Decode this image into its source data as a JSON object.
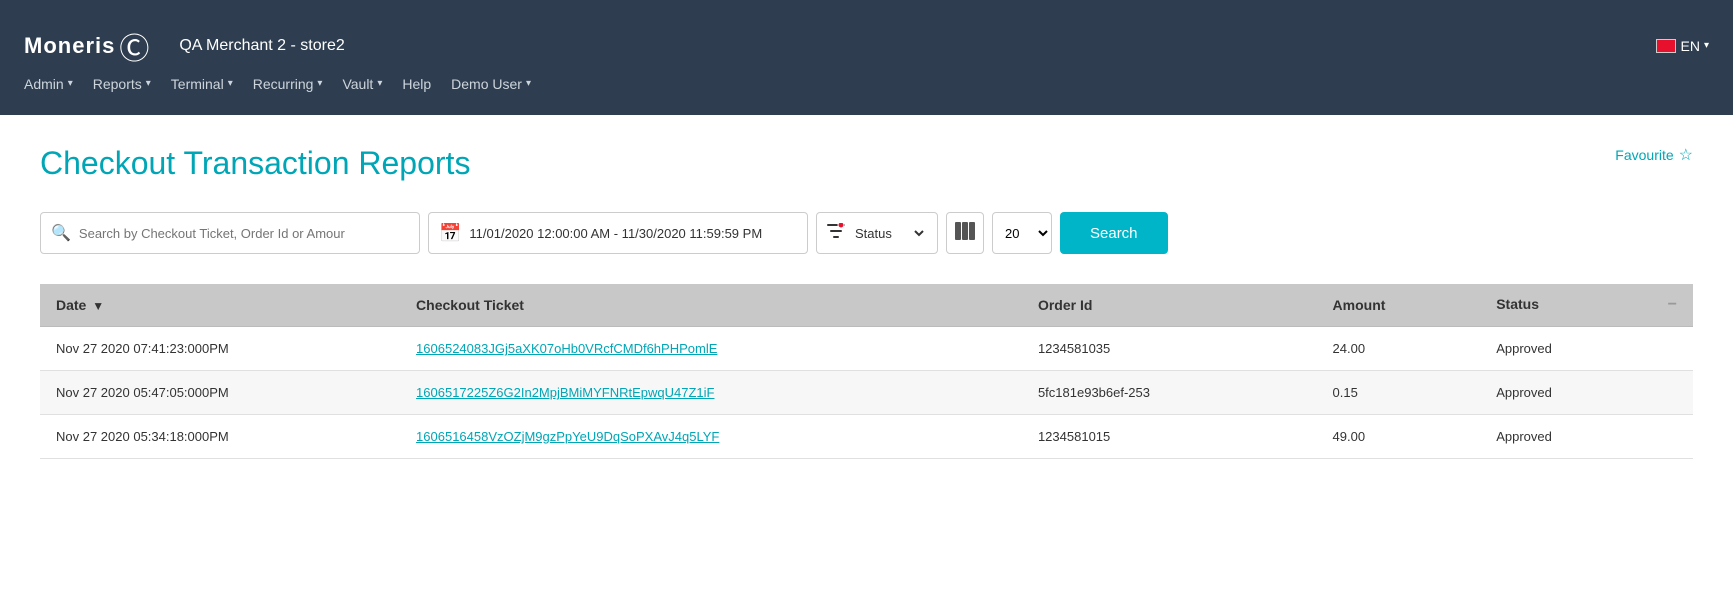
{
  "header": {
    "logo_text": "Moneris",
    "merchant_name": "QA Merchant 2 - store2",
    "lang": "EN",
    "nav_items": [
      {
        "label": "Admin",
        "has_arrow": true
      },
      {
        "label": "Reports",
        "has_arrow": true
      },
      {
        "label": "Terminal",
        "has_arrow": true
      },
      {
        "label": "Recurring",
        "has_arrow": true
      },
      {
        "label": "Vault",
        "has_arrow": true
      },
      {
        "label": "Help",
        "has_arrow": false
      },
      {
        "label": "Demo User",
        "has_arrow": true
      }
    ]
  },
  "page": {
    "title": "Checkout Transaction Reports",
    "favourite_label": "Favourite"
  },
  "search": {
    "placeholder": "Search by Checkout Ticket, Order Id or Amour",
    "date_range": "11/01/2020 12:00:00 AM - 11/30/2020 11:59:59 PM",
    "status_label": "Status",
    "per_page_value": "20",
    "button_label": "Search"
  },
  "table": {
    "columns": [
      {
        "label": "Date",
        "sort": true
      },
      {
        "label": "Checkout Ticket",
        "sort": false
      },
      {
        "label": "Order Id",
        "sort": false
      },
      {
        "label": "Amount",
        "sort": false
      },
      {
        "label": "Status",
        "sort": false
      }
    ],
    "rows": [
      {
        "date": "Nov 27 2020 07:41:23:000PM",
        "ticket": "1606524083JGj5aXK07oHb0VRcfCMDf6hPHPomlE",
        "order_id": "1234581035",
        "amount": "24.00",
        "status": "Approved"
      },
      {
        "date": "Nov 27 2020 05:47:05:000PM",
        "ticket": "1606517225Z6G2In2MpjBMiMYFNRtEpwqU47Z1iF",
        "order_id": "5fc181e93b6ef-253",
        "amount": "0.15",
        "status": "Approved"
      },
      {
        "date": "Nov 27 2020 05:34:18:000PM",
        "ticket": "1606516458VzOZjM9gzPpYeU9DqSoPXAvJ4q5LYF",
        "order_id": "1234581015",
        "amount": "49.00",
        "status": "Approved"
      }
    ]
  }
}
